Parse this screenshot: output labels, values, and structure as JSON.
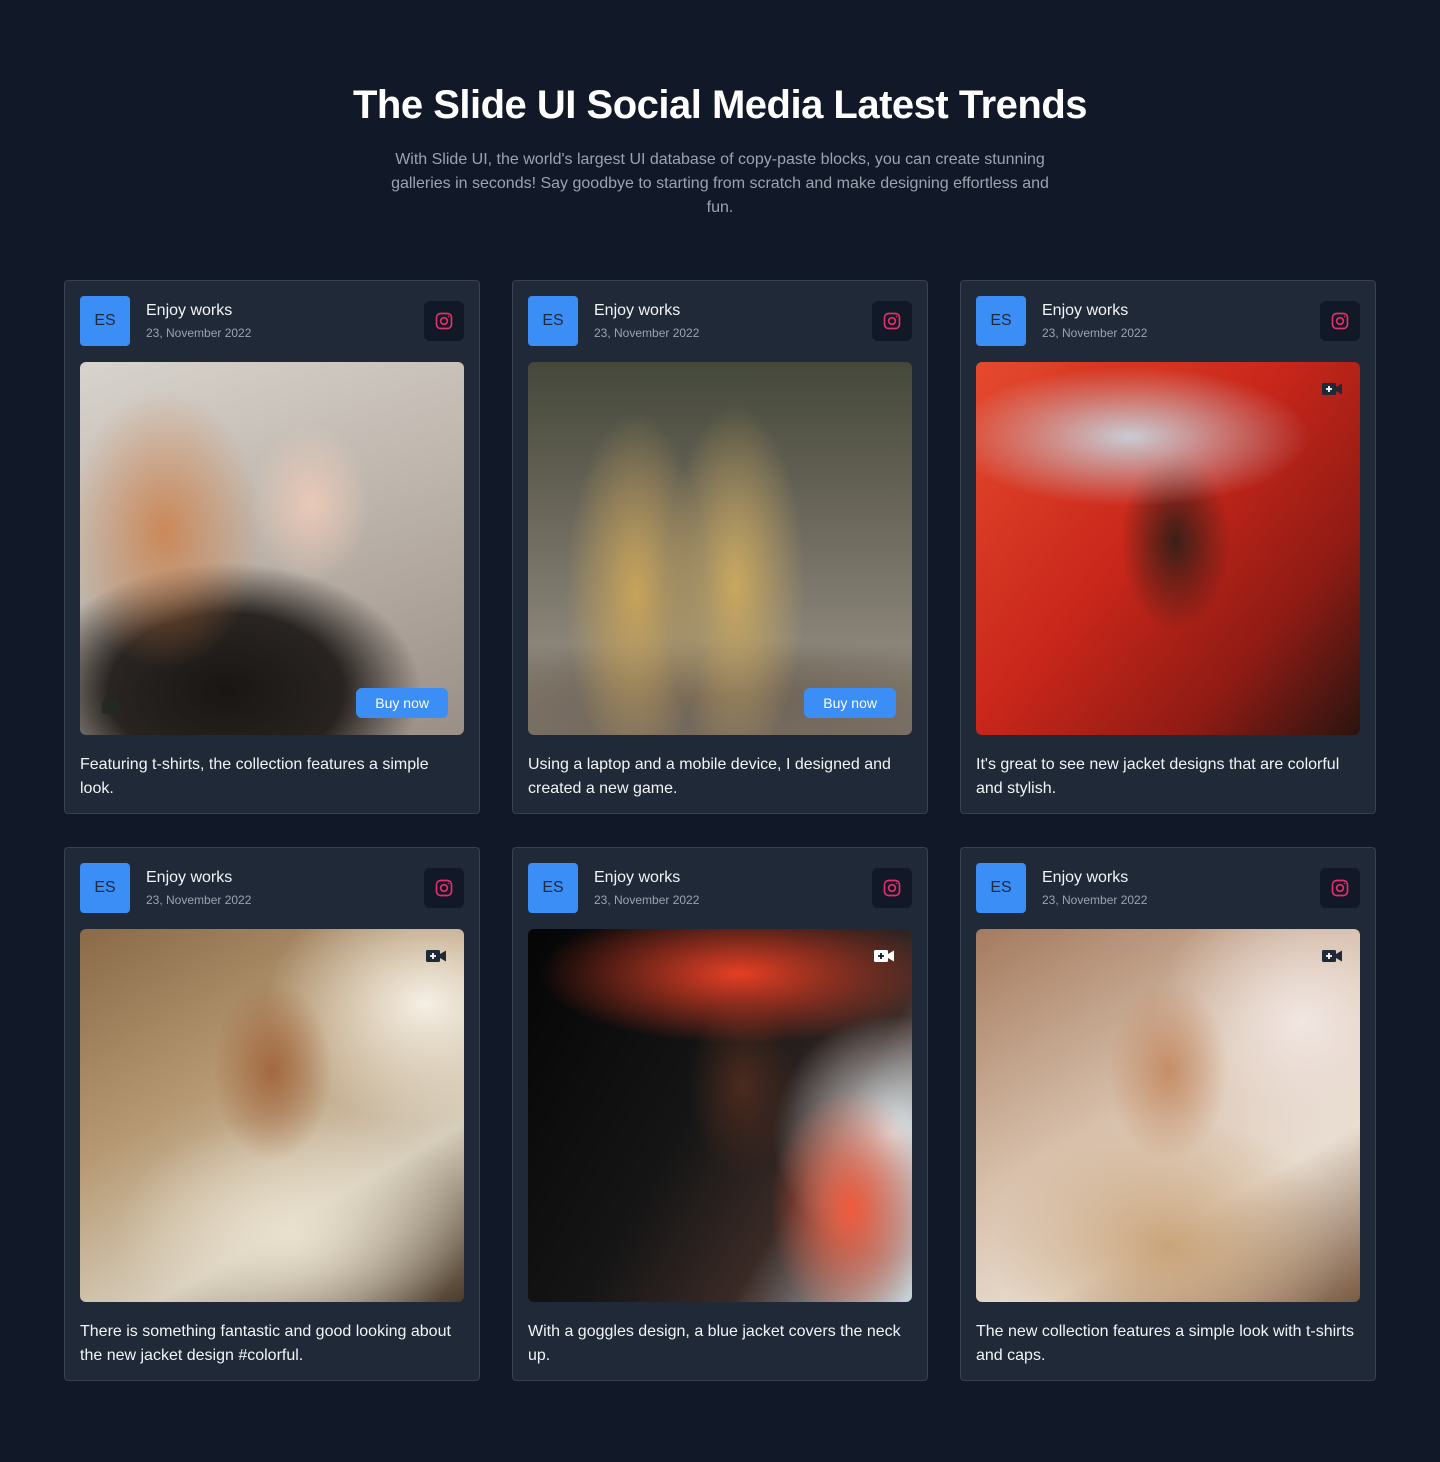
{
  "header": {
    "title": "The Slide UI Social Media Latest Trends",
    "subtitle": "With Slide UI, the world's largest UI database of copy-paste blocks, you can create stunning galleries in seconds! Say goodbye to starting from scratch and make designing effortless and fun."
  },
  "colors": {
    "background": "#111827",
    "card": "#1f2937",
    "accent": "#3b8ef5",
    "instagram": "#e1306c"
  },
  "icons": {
    "social": "instagram-icon",
    "media_video": "video-camera-icon",
    "media_lock": "lock-icon"
  },
  "cards": [
    {
      "avatar": "ES",
      "author": "Enjoy works",
      "date": "23, November 2022",
      "buy_label": "Buy now",
      "caption": "Featuring t-shirts, the collection features a simple look."
    },
    {
      "avatar": "ES",
      "author": "Enjoy works",
      "date": "23, November 2022",
      "buy_label": "Buy now",
      "caption": "Using a laptop and a mobile device, I designed and created a new game."
    },
    {
      "avatar": "ES",
      "author": "Enjoy works",
      "date": "23, November 2022",
      "caption": "It's great to see new jacket designs that are colorful and stylish."
    },
    {
      "avatar": "ES",
      "author": "Enjoy works",
      "date": "23, November 2022",
      "caption": "There is something fantastic and good looking about the new jacket design #colorful."
    },
    {
      "avatar": "ES",
      "author": "Enjoy works",
      "date": "23, November 2022",
      "caption": "With a goggles design, a blue jacket covers the neck up."
    },
    {
      "avatar": "ES",
      "author": "Enjoy works",
      "date": "23, November 2022",
      "caption": "The new collection features a simple look with t-shirts and caps."
    }
  ]
}
